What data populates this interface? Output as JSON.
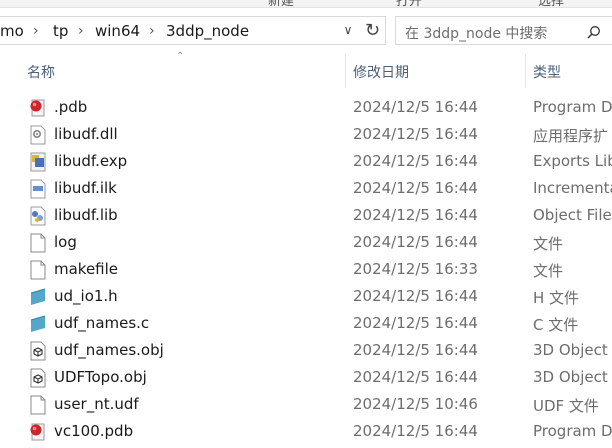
{
  "ribbon": [
    "新建",
    "打开",
    "选择"
  ],
  "address": {
    "crumbs": [
      "mo",
      "tp",
      "win64",
      "3ddp_node"
    ],
    "separator": "›"
  },
  "search": {
    "placeholder": "在 3ddp_node 中搜索"
  },
  "columns": {
    "name": "名称",
    "date": "修改日期",
    "type": "类型"
  },
  "files": [
    {
      "name": ".pdb",
      "date": "2024/12/5 16:44",
      "type": "Program D",
      "icon": "pdb-icon"
    },
    {
      "name": "libudf.dll",
      "date": "2024/12/5 16:44",
      "type": "应用程序扩",
      "icon": "dll-icon"
    },
    {
      "name": "libudf.exp",
      "date": "2024/12/5 16:44",
      "type": "Exports Lib",
      "icon": "exp-icon"
    },
    {
      "name": "libudf.ilk",
      "date": "2024/12/5 16:44",
      "type": "Incrementa",
      "icon": "ilk-icon"
    },
    {
      "name": "libudf.lib",
      "date": "2024/12/5 16:44",
      "type": "Object File",
      "icon": "lib-icon"
    },
    {
      "name": "log",
      "date": "2024/12/5 16:44",
      "type": "文件",
      "icon": "blank-file-icon"
    },
    {
      "name": "makefile",
      "date": "2024/12/5 16:33",
      "type": "文件",
      "icon": "blank-file-icon"
    },
    {
      "name": "ud_io1.h",
      "date": "2024/12/5 16:44",
      "type": "H 文件",
      "icon": "header-file-icon"
    },
    {
      "name": "udf_names.c",
      "date": "2024/12/5 16:44",
      "type": "C 文件",
      "icon": "c-file-icon"
    },
    {
      "name": "udf_names.obj",
      "date": "2024/12/5 16:44",
      "type": "3D Object",
      "icon": "obj-icon"
    },
    {
      "name": "UDFTopo.obj",
      "date": "2024/12/5 16:44",
      "type": "3D Object",
      "icon": "obj-icon"
    },
    {
      "name": "user_nt.udf",
      "date": "2024/12/5 10:46",
      "type": "UDF 文件",
      "icon": "blank-file-icon"
    },
    {
      "name": "vc100.pdb",
      "date": "2024/12/5 16:44",
      "type": "Program D",
      "icon": "pdb-icon"
    }
  ]
}
